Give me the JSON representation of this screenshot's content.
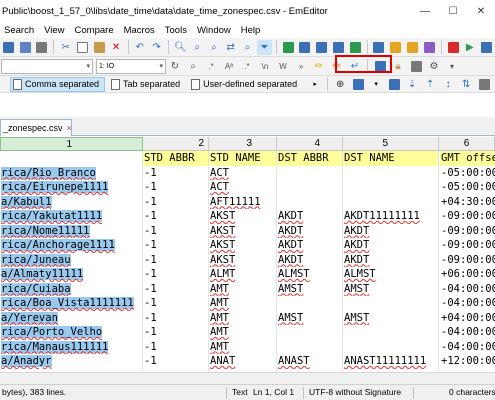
{
  "window": {
    "title": "Public\\boost_1_57_0\\libs\\date_time\\data\\date_time_zonespec.csv - EmEditor",
    "minimize": "—",
    "maximize": "☐",
    "close": "✕"
  },
  "menu": [
    "Search",
    "View",
    "Compare",
    "Macros",
    "Tools",
    "Window",
    "Help"
  ],
  "toolbar2": {
    "font_size_value": "1: IO"
  },
  "csv_toolbar": {
    "comma": "Comma separated",
    "tab": "Tab separated",
    "user": "User-defined separated"
  },
  "tab": {
    "label": "_zonespec.csv",
    "close": "×"
  },
  "grid": {
    "headers": [
      "1",
      "2",
      "3",
      "4",
      "5",
      "6"
    ],
    "header_row": [
      "",
      "STD ABBR",
      "STD NAME",
      "DST ABBR",
      "DST NAME",
      "GMT offse"
    ],
    "rows": [
      [
        "rica/Rio_Branco",
        "-1",
        "ACT",
        "",
        "",
        "-05:00:00"
      ],
      [
        "rica/Eirunepe1111",
        "-1",
        "ACT",
        "",
        "",
        "-05:00:00"
      ],
      [
        "a/Kabul1",
        "-1",
        "AFT11111",
        "",
        "",
        "+04:30:00"
      ],
      [
        "rica/Yakutat1111",
        "-1",
        "AKST",
        "AKDT",
        "AKDT11111111",
        "-09:00:00"
      ],
      [
        "rica/Nome11111",
        "-1",
        "AKST",
        "AKDT",
        "AKDT",
        "-09:00:00"
      ],
      [
        "rica/Anchorage1111",
        "-1",
        "AKST",
        "AKDT",
        "AKDT",
        "-09:00:00"
      ],
      [
        "rica/Juneau",
        "-1",
        "AKST",
        "AKDT",
        "AKDT",
        "-09:00:00"
      ],
      [
        "a/Almaty11111",
        "-1",
        "ALMT",
        "ALMST",
        "ALMST",
        "+06:00:00"
      ],
      [
        "rica/Cuiaba",
        "-1",
        "AMT",
        "AMST",
        "AMST",
        "-04:00:00"
      ],
      [
        "rica/Boa_Vista1111111",
        "-1",
        "AMT",
        "",
        "",
        "-04:00:00"
      ],
      [
        "a/Yerevan",
        "-1",
        "AMT",
        "AMST",
        "AMST",
        "+04:00:00"
      ],
      [
        "rica/Porto_Velho",
        "-1",
        "AMT",
        "",
        "",
        "-04:00:00"
      ],
      [
        "rica/Manaus111111",
        "-1",
        "AMT",
        "",
        "",
        "-04:00:00"
      ],
      [
        "a/Anadyr",
        "-1",
        "ANAT",
        "ANAST",
        "ANAST11111111",
        "+12:00:00"
      ]
    ]
  },
  "status": {
    "size": "bytes), 383 lines.",
    "mode": "Text",
    "position": "Ln 1, Col 1",
    "encoding": "UTF-8 without Signature",
    "chars": "0 characters"
  },
  "colors": {
    "selection": "#99c9ef",
    "header_highlight": "#ffff99",
    "callout": "#e00000"
  }
}
